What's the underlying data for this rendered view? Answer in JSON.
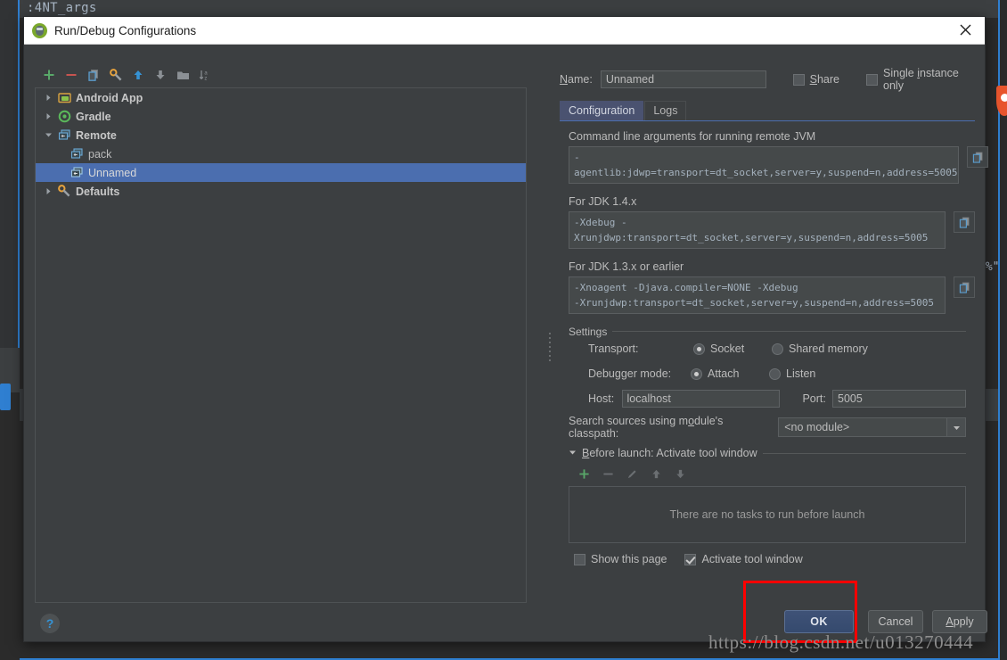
{
  "background": {
    "code_line": ":4NT_args",
    "code_fragment": "H%\"",
    "orange_icon": "flame-icon"
  },
  "dialog": {
    "title": "Run/Debug Configurations",
    "title_icon": "android-studio-icon",
    "close_icon": "close-icon"
  },
  "tree_toolbar": [
    {
      "name": "add-button",
      "icon": "plus-icon",
      "color": "#59a869"
    },
    {
      "name": "remove-button",
      "icon": "minus-icon",
      "color": "#c75450"
    },
    {
      "name": "copy-button",
      "icon": "copy-icon",
      "color": "#5a9ed0"
    },
    {
      "name": "edit-defaults-button",
      "icon": "wrench-icon",
      "color": "#e8a33d"
    },
    {
      "name": "move-up-button",
      "icon": "arrow-up-icon",
      "color": "#3592d4"
    },
    {
      "name": "move-down-button",
      "icon": "arrow-down-icon",
      "color": "#9aa0a6"
    },
    {
      "name": "folder-button",
      "icon": "folder-icon",
      "color": "#9aa0a6"
    },
    {
      "name": "sort-button",
      "icon": "sort-alpha-icon",
      "color": "#9aa0a6"
    }
  ],
  "tree": [
    {
      "label": "Android App",
      "icon": "android-icon",
      "expanded": false,
      "level": 0,
      "selected": false,
      "bold": true
    },
    {
      "label": "Gradle",
      "icon": "gradle-icon",
      "expanded": false,
      "level": 0,
      "selected": false,
      "bold": true
    },
    {
      "label": "Remote",
      "icon": "remote-icon",
      "expanded": true,
      "level": 0,
      "selected": false,
      "bold": true
    },
    {
      "label": "pack",
      "icon": "remote-icon",
      "expanded": null,
      "level": 1,
      "selected": false,
      "bold": false
    },
    {
      "label": "Unnamed",
      "icon": "remote-icon",
      "expanded": null,
      "level": 1,
      "selected": true,
      "bold": false
    },
    {
      "label": "Defaults",
      "icon": "wrench-icon",
      "expanded": false,
      "level": 0,
      "selected": false,
      "bold": true
    }
  ],
  "form": {
    "name_label": "Name:",
    "name_value": "Unnamed",
    "share_label": "Share",
    "share_checked": false,
    "single_instance_label": "Single instance only",
    "single_instance_checked": false
  },
  "tabs": [
    {
      "label": "Configuration",
      "active": true
    },
    {
      "label": "Logs",
      "active": false
    }
  ],
  "config": {
    "cmdline_label": "Command line arguments for running remote JVM",
    "cmdline_value": "-agentlib:jdwp=transport=dt_socket,server=y,suspend=n,address=5005",
    "jdk14_label": "For JDK 1.4.x",
    "jdk14_value": "-Xdebug -Xrunjdwp:transport=dt_socket,server=y,suspend=n,address=5005",
    "jdk13_label": "For JDK 1.3.x or earlier",
    "jdk13_value_line1": "-Xnoagent -Djava.compiler=NONE -Xdebug",
    "jdk13_value_line2": "-Xrunjdwp:transport=dt_socket,server=y,suspend=n,address=5005",
    "copy_icon": "copy-icon"
  },
  "settings": {
    "group_title": "Settings",
    "transport_label": "Transport:",
    "transport_options": [
      {
        "label": "Socket",
        "selected": true
      },
      {
        "label": "Shared memory",
        "selected": false
      }
    ],
    "debugger_mode_label": "Debugger mode:",
    "debugger_mode_options": [
      {
        "label": "Attach",
        "selected": true
      },
      {
        "label": "Listen",
        "selected": false
      }
    ],
    "host_label": "Host:",
    "host_value": "localhost",
    "port_label": "Port:",
    "port_value": "5005",
    "classpath_label": "Search sources using module's classpath:",
    "classpath_value": "<no module>",
    "classpath_arrow_icon": "chevron-down-icon"
  },
  "before_launch": {
    "title": "Before launch: Activate tool window",
    "collapse_icon": "triangle-down-icon",
    "toolbar": [
      {
        "name": "add-task-button",
        "icon": "plus-icon",
        "enabled": true
      },
      {
        "name": "remove-task-button",
        "icon": "minus-icon",
        "enabled": false
      },
      {
        "name": "edit-task-button",
        "icon": "pencil-icon",
        "enabled": false
      },
      {
        "name": "move-task-up-button",
        "icon": "arrow-up-icon",
        "enabled": false
      },
      {
        "name": "move-task-down-button",
        "icon": "arrow-down-icon",
        "enabled": false
      }
    ],
    "empty_text": "There are no tasks to run before launch",
    "show_page_label": "Show this page",
    "show_page_checked": false,
    "activate_tool_window_label": "Activate tool window",
    "activate_tool_window_checked": true
  },
  "buttons": {
    "help": "?",
    "ok": "OK",
    "cancel": "Cancel",
    "apply": "Apply"
  },
  "annotation": {
    "highlight_color": "#ff0000",
    "watermark": "https://blog.csdn.net/u013270444"
  }
}
